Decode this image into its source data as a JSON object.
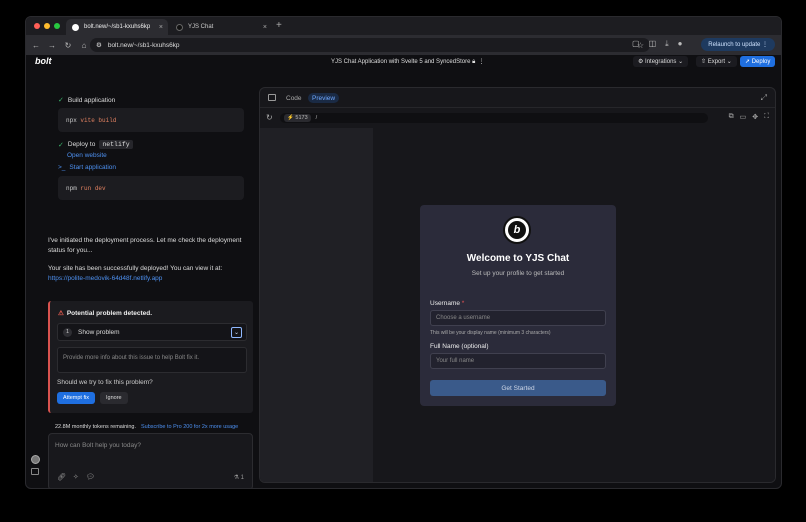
{
  "browser": {
    "tabs": [
      {
        "title": "bolt.new/~/sb1-kxuhs6kp",
        "active": true
      },
      {
        "title": "YJS Chat",
        "active": false
      }
    ],
    "url": "bolt.new/~/sb1-kxuhs6kp",
    "relaunch_label": "Relaunch to update"
  },
  "header": {
    "logo": "bolt",
    "project_title": "YJS Chat Application with Svelte 5 and SyncedStore",
    "integrations_label": "Integrations",
    "export_label": "Export",
    "deploy_label": "Deploy"
  },
  "chat": {
    "steps": [
      {
        "label": "Build application"
      },
      {
        "label": "Deploy to",
        "code": "netlify",
        "link": "Open website"
      },
      {
        "label": "Start application"
      }
    ],
    "code_build": {
      "cmd": "npx",
      "arg": "vite build"
    },
    "code_dev": {
      "cmd": "npm",
      "arg": "run dev"
    },
    "message1_line1": "I've initiated the deployment process. Let me check the deployment",
    "message1_line2": "status for you...",
    "message2": "Your site has been successfully deployed! You can view it at:",
    "deploy_link": "https://polite-medovik-64d48f.netlify.app",
    "problem": {
      "title": "Potential problem detected.",
      "step_num": "1",
      "show_label": "Show problem",
      "input_placeholder": "Provide more info about this issue to help Bolt fix it.",
      "question": "Should we try to fix this problem?",
      "attempt_label": "Attempt fix",
      "ignore_label": "Ignore"
    },
    "tokens_text": "22.8M monthly tokens remaining.",
    "tokens_link": "Subscribe to Pro 200 for 2x more usage",
    "prompt_placeholder": "How can Bolt help you today?",
    "prompt_count": "1"
  },
  "preview": {
    "tabs": [
      {
        "label": "Code",
        "active": false
      },
      {
        "label": "Preview",
        "active": true
      }
    ],
    "port": "5173",
    "path": "/",
    "app": {
      "title": "Welcome to YJS Chat",
      "subtitle": "Set up your profile to get started",
      "username_label": "Username",
      "username_required": "*",
      "username_placeholder": "Choose a username",
      "username_hint": "This will be your display name (minimum 3 characters)",
      "fullname_label": "Full Name (optional)",
      "fullname_placeholder": "Your full name",
      "submit_label": "Get Started"
    }
  },
  "colors": {
    "accent": "#1f6fe0",
    "link": "#4d90f0",
    "success": "#3bb56b",
    "danger": "#d9534f"
  }
}
